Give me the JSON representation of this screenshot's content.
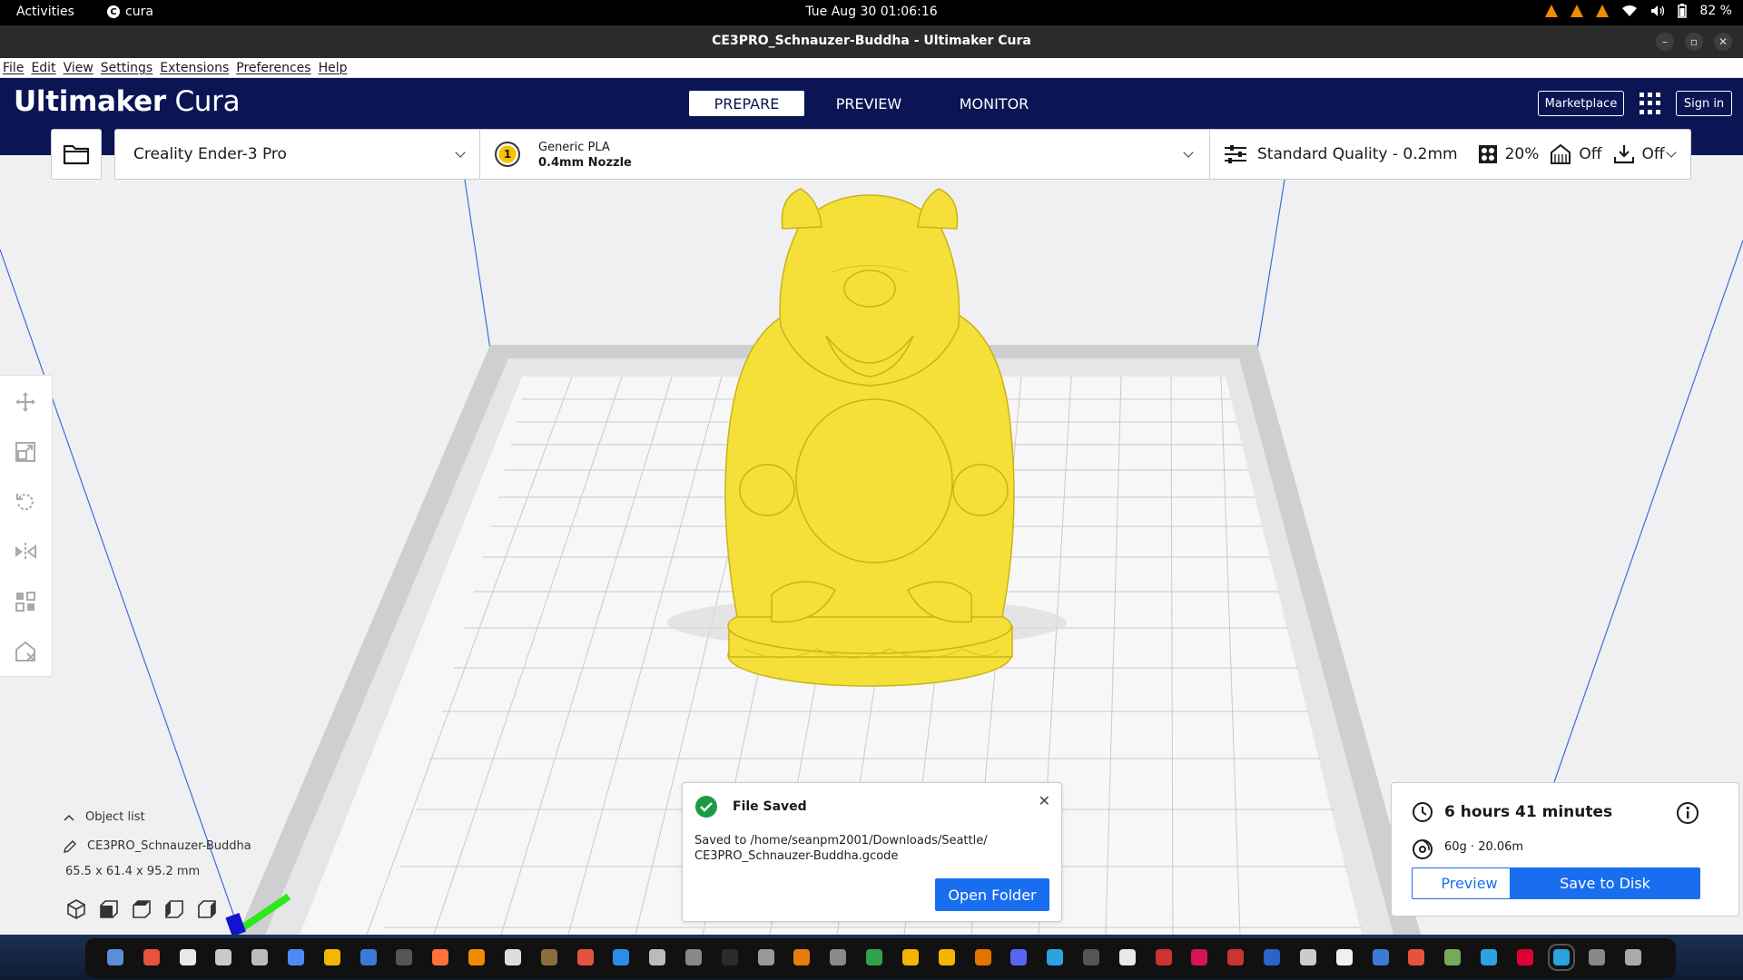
{
  "system_bar": {
    "activities": "Activities",
    "app_name": "cura",
    "clock": "Tue Aug 30  01:06:16",
    "battery": "82 %"
  },
  "window": {
    "title": "CE3PRO_Schnauzer-Buddha - Ultimaker Cura"
  },
  "menu": [
    "File",
    "Edit",
    "View",
    "Settings",
    "Extensions",
    "Preferences",
    "Help"
  ],
  "header": {
    "logo_bold": "Ultimaker",
    "logo_light": "Cura",
    "tabs": [
      "PREPARE",
      "PREVIEW",
      "MONITOR"
    ],
    "active_tab": "PREPARE",
    "marketplace": "Marketplace",
    "sign_in": "Sign in"
  },
  "config": {
    "printer": "Creality Ender-3 Pro",
    "extruder_number": "1",
    "material": "Generic PLA",
    "nozzle": "0.4mm Nozzle",
    "profile": "Standard Quality - 0.2mm",
    "infill": "20%",
    "support": "Off",
    "adhesion": "Off"
  },
  "object_list": {
    "label": "Object list",
    "object_name": "CE3PRO_Schnauzer-Buddha",
    "dimensions": "65.5 x 61.4 x 95.2 mm"
  },
  "message": {
    "title": "File Saved",
    "body": "Saved to /home/seanpm2001/Downloads/Seattle/ CE3PRO_Schnauzer-Buddha.gcode",
    "action": "Open Folder"
  },
  "print_info": {
    "time": "6 hours 41 minutes",
    "material": "60g · 20.06m",
    "preview": "Preview",
    "save": "Save to Disk"
  },
  "colors": {
    "header": "#0b1554",
    "accent": "#196ef0",
    "model": "#f7e84a",
    "success": "#1a9c44"
  },
  "taskbar_apps": [
    "files",
    "chrome",
    "notes",
    "text-editor",
    "search",
    "docs",
    "archive",
    "writer",
    "terminal",
    "firefox",
    "vlc",
    "obs",
    "gimp",
    "screenshot",
    "help",
    "monitor",
    "camera",
    "inkscape",
    "tweaks",
    "blender",
    "preferences",
    "calc",
    "sandbox",
    "writer2",
    "presentation",
    "discord",
    "telegram",
    "steam",
    "photos",
    "krita",
    "ring",
    "gift",
    "vm",
    "audacity",
    "network",
    "remote",
    "java",
    "mc",
    "cura",
    "resolve",
    "cura-active",
    "files2",
    "app-grid"
  ]
}
